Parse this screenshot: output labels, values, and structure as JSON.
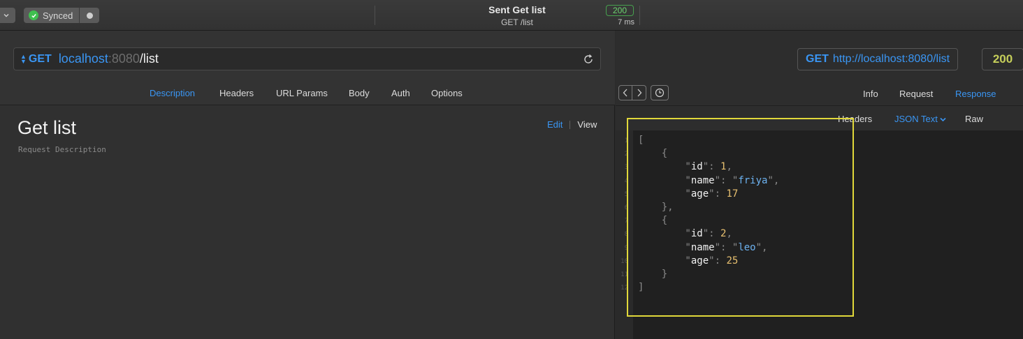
{
  "titlebar": {
    "sync_label": "Synced",
    "status_title": "Sent Get list",
    "status_subtitle": "GET /list",
    "status_code": "200",
    "elapsed": "7 ms"
  },
  "request": {
    "method": "GET",
    "url_host": "localhost",
    "url_port": ":8080",
    "url_path": "/list",
    "tabs": [
      "Description",
      "Headers",
      "URL Params",
      "Body",
      "Auth",
      "Options"
    ],
    "active_tab": "Description",
    "title": "Get list",
    "description_placeholder": "Request Description",
    "edit_label": "Edit",
    "view_label": "View"
  },
  "response": {
    "method": "GET",
    "url": "http://localhost:8080/list",
    "status_code": "200",
    "tabs": [
      "Info",
      "Request",
      "Response"
    ],
    "active_tab": "Response",
    "subtabs": [
      "Headers",
      "JSON Text",
      "Raw"
    ],
    "active_subtab": "JSON Text",
    "line_numbers": [
      "1",
      "2",
      "3",
      "4",
      "5",
      "6",
      "7",
      "8",
      "9",
      "10",
      "11",
      "12"
    ],
    "body": [
      {
        "id": 1,
        "name": "friya",
        "age": 17
      },
      {
        "id": 2,
        "name": "leo",
        "age": 25
      }
    ]
  },
  "colors": {
    "accent": "#3a96f4",
    "status_ok": "#6bd36e",
    "highlight": "#e1d83a"
  }
}
